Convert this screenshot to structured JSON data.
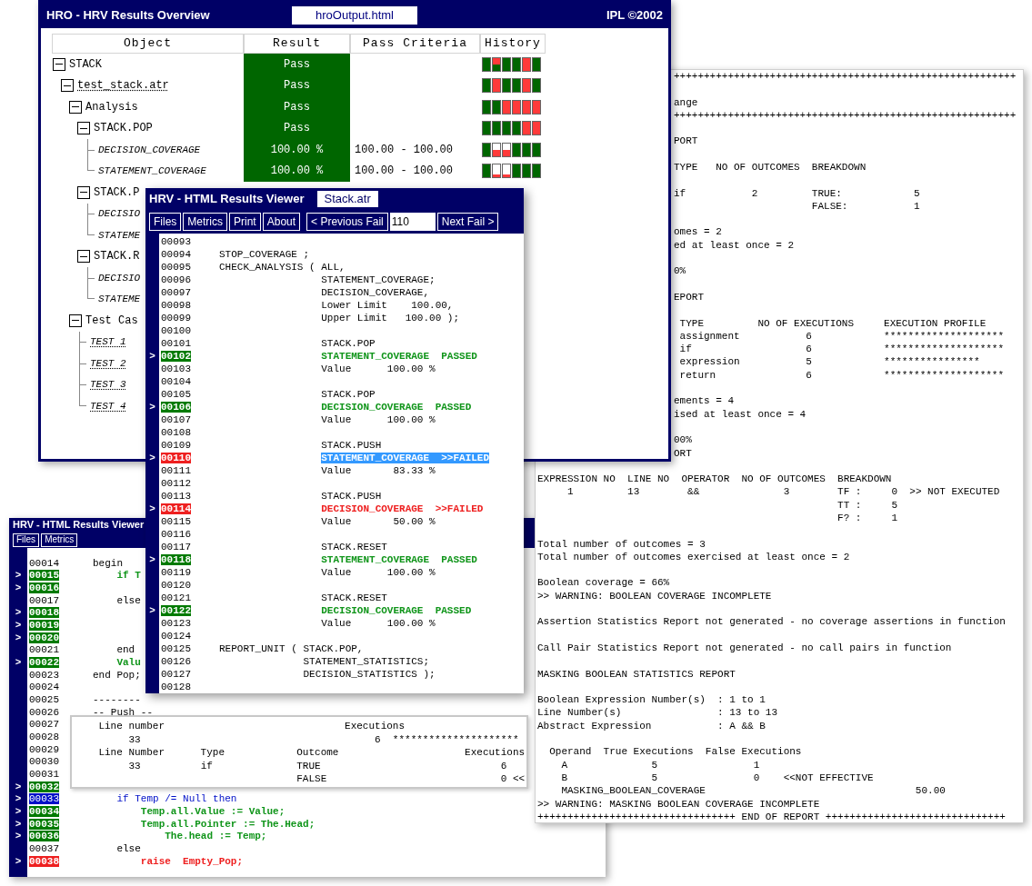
{
  "report_window": {
    "upper_blocks": [
      [
        "+++++++++++++++++++++++++++++++++++++++++++++++++++++++++"
      ],
      [
        "ange",
        "+++++++++++++++++++++++++++++++++++++++++++++++++++++++++"
      ],
      [
        "PORT"
      ],
      [
        "TYPE   NO OF OUTCOMES  BREAKDOWN"
      ],
      [
        "if           2         TRUE:            5",
        "                       FALSE:           1"
      ],
      [
        "omes = 2",
        "ed at least once = 2"
      ],
      [
        "0%"
      ],
      [
        "EPORT"
      ],
      [
        " TYPE         NO OF EXECUTIONS     EXECUTION PROFILE",
        " assignment           6            ********************",
        " if                   6            ********************",
        " expression           5            ****************",
        " return               6            ********************"
      ],
      [
        "ements = 4",
        "ised at least once = 4"
      ],
      [
        "00%",
        "ORT"
      ]
    ],
    "lower_blocks": [
      [
        "EXPRESSION NO  LINE NO  OPERATOR  NO OF OUTCOMES  BREAKDOWN",
        "     1         13        &&              3        TF :     0  >> NOT EXECUTED",
        "                                                  TT :     5",
        "                                                  F? :     1"
      ],
      [
        "Total number of outcomes = 3",
        "Total number of outcomes exercised at least once = 2"
      ],
      [
        "Boolean coverage = 66%",
        ">> WARNING: BOOLEAN COVERAGE INCOMPLETE"
      ],
      [
        "Assertion Statistics Report not generated - no coverage assertions in function"
      ],
      [
        "Call Pair Statistics Report not generated - no call pairs in function"
      ],
      [
        "MASKING BOOLEAN STATISTICS REPORT"
      ],
      [
        "Boolean Expression Number(s)  : 1 to 1",
        "Line Number(s)                : 13 to 13",
        "Abstract Expression           : A && B"
      ],
      [
        "  Operand  True Executions  False Executions",
        "    A              5                1",
        "    B              5                0    <<NOT EFFECTIVE",
        "    MASKING_BOOLEAN_COVERAGE                                   50.00",
        ">> WARNING: MASKING BOOLEAN COVERAGE INCOMPLETE",
        "+++++++++++++++++++++++++++++++++ END OF REPORT ++++++++++++++++++++++++++++++"
      ]
    ]
  },
  "overview_window": {
    "title": "HRO - HRV Results Overview",
    "file": "hroOutput.html",
    "copyright": "IPL ©2002",
    "columns": [
      "Object",
      "Result",
      "Pass Criteria",
      "History"
    ],
    "tree": [
      {
        "label": "STACK",
        "kind": "node",
        "expanded": true,
        "result": "Pass",
        "history": [
          {
            "kind": "pass"
          },
          {
            "kind": "fail_over_pass"
          },
          {
            "kind": "pass"
          },
          {
            "kind": "pass"
          },
          {
            "kind": "fail"
          },
          {
            "kind": "pass"
          }
        ],
        "children": [
          {
            "label": "test_stack.atr",
            "kind": "file",
            "expanded": true,
            "result": "Pass",
            "history": [
              {
                "kind": "pass"
              },
              {
                "kind": "fail"
              },
              {
                "kind": "pass"
              },
              {
                "kind": "pass"
              },
              {
                "kind": "fail"
              },
              {
                "kind": "pass"
              }
            ],
            "children": [
              {
                "label": "Analysis",
                "kind": "node",
                "expanded": true,
                "result": "Pass",
                "history": [
                  {
                    "kind": "pass"
                  },
                  {
                    "kind": "pass"
                  },
                  {
                    "kind": "fail"
                  },
                  {
                    "kind": "fail"
                  },
                  {
                    "kind": "fail"
                  },
                  {
                    "kind": "fail"
                  }
                ],
                "children": [
                  {
                    "label": "STACK.POP",
                    "kind": "node",
                    "expanded": true,
                    "result": "Pass",
                    "history": [
                      {
                        "kind": "pass"
                      },
                      {
                        "kind": "pass"
                      },
                      {
                        "kind": "pass"
                      },
                      {
                        "kind": "pass"
                      },
                      {
                        "kind": "fail"
                      },
                      {
                        "kind": "fail"
                      }
                    ],
                    "children": [
                      {
                        "label": "DECISION_COVERAGE",
                        "kind": "metric",
                        "result": "100.00 %",
                        "criteria": "100.00 - 100.00",
                        "history": [
                          {
                            "kind": "pass"
                          },
                          {
                            "kind": "partial",
                            "level": 0.45
                          },
                          {
                            "kind": "partial",
                            "level": 0.45
                          },
                          {
                            "kind": "pass"
                          },
                          {
                            "kind": "pass"
                          },
                          {
                            "kind": "pass"
                          }
                        ]
                      },
                      {
                        "label": "STATEMENT_COVERAGE",
                        "kind": "metric",
                        "result": "100.00 %",
                        "criteria": "100.00 - 100.00",
                        "history": [
                          {
                            "kind": "pass"
                          },
                          {
                            "kind": "partial",
                            "level": 0.2
                          },
                          {
                            "kind": "partial",
                            "level": 0.2
                          },
                          {
                            "kind": "pass"
                          },
                          {
                            "kind": "pass"
                          },
                          {
                            "kind": "pass"
                          }
                        ]
                      }
                    ]
                  },
                  {
                    "label": "STACK.P",
                    "kind": "node",
                    "expanded": true,
                    "children": [
                      {
                        "label": "DECISIO",
                        "kind": "metric"
                      },
                      {
                        "label": "STATEME",
                        "kind": "metric"
                      }
                    ]
                  },
                  {
                    "label": "STACK.R",
                    "kind": "node",
                    "expanded": true,
                    "children": [
                      {
                        "label": "DECISIO",
                        "kind": "metric"
                      },
                      {
                        "label": "STATEME",
                        "kind": "metric"
                      }
                    ]
                  }
                ]
              },
              {
                "label": "Test Cas",
                "kind": "node",
                "expanded": true,
                "children": [
                  {
                    "label": "TEST 1",
                    "kind": "test"
                  },
                  {
                    "label": "TEST 2",
                    "kind": "test"
                  },
                  {
                    "label": "TEST 3",
                    "kind": "test"
                  },
                  {
                    "label": "TEST 4",
                    "kind": "test"
                  }
                ]
              }
            ]
          }
        ]
      }
    ]
  },
  "lower_viewer": {
    "title": "HRV - HTML Results Viewer",
    "buttons": [
      "Files",
      "Metrics"
    ],
    "lines": [
      {
        "number": "00014",
        "kind": "plain",
        "code": "begin"
      },
      {
        "number": "00015",
        "kind": "pass",
        "marker": ">",
        "code": "    if T"
      },
      {
        "number": "00016",
        "kind": "pass",
        "marker": ">"
      },
      {
        "number": "00017",
        "kind": "plain",
        "code": "    else"
      },
      {
        "number": "00018",
        "kind": "pass",
        "marker": ">"
      },
      {
        "number": "00019",
        "kind": "pass",
        "marker": ">"
      },
      {
        "number": "00020",
        "kind": "pass",
        "marker": ">"
      },
      {
        "number": "00021",
        "kind": "plain",
        "code": "    end"
      },
      {
        "number": "00022",
        "kind": "pass",
        "marker": ">",
        "code": "    Valu"
      },
      {
        "number": "00023",
        "kind": "plain",
        "code": "end Pop;"
      },
      {
        "number": "00024",
        "kind": "plain"
      },
      {
        "number": "00025",
        "kind": "plain",
        "code": "--------"
      },
      {
        "number": "00026",
        "kind": "plain",
        "code": "-- Push --"
      },
      {
        "number": "00027",
        "kind": "plain"
      },
      {
        "number": "00028",
        "kind": "plain"
      },
      {
        "number": "00029",
        "kind": "plain"
      },
      {
        "number": "00030",
        "kind": "plain"
      },
      {
        "number": "00031",
        "kind": "plain"
      },
      {
        "number": "00032",
        "kind": "pass",
        "marker": ">"
      },
      {
        "number": "00033",
        "kind": "current",
        "marker": ">",
        "code": "    if Temp /= Null then"
      },
      {
        "number": "00034",
        "kind": "pass",
        "marker": ">",
        "code": "        Temp.all.Value := Value;"
      },
      {
        "number": "00035",
        "kind": "pass",
        "marker": ">",
        "code": "        Temp.all.Pointer := The.Head;"
      },
      {
        "number": "00036",
        "kind": "pass",
        "marker": ">",
        "code": "            The.head := Temp;"
      },
      {
        "number": "00037",
        "kind": "plain",
        "code": "    else"
      },
      {
        "number": "00038",
        "kind": "fail",
        "marker": ">",
        "code": "        raise  Empty_Pop;"
      }
    ],
    "popup": [
      "    Line number                              Executions",
      "         33                                       6  *********************",
      "    Line Number      Type            Outcome                     Executions",
      "         33          if              TRUE                              6",
      "                                     FALSE                             0 <<"
    ]
  },
  "viewer_window": {
    "title": "HRV - HTML Results Viewer",
    "tab": "Stack.atr",
    "buttons": [
      "Files",
      "Metrics",
      "Print",
      "About"
    ],
    "previous": "< Previous Fail",
    "fail_line": "110",
    "next": "Next Fail >",
    "lines": [
      {
        "number": "00093",
        "kind": "plain",
        "selected": false
      },
      {
        "number": "00094",
        "kind": "plain",
        "selected": false,
        "code": "STOP_COVERAGE ;"
      },
      {
        "number": "00095",
        "kind": "plain",
        "selected": false,
        "code": "CHECK_ANALYSIS ( ALL,"
      },
      {
        "number": "00096",
        "kind": "plain",
        "selected": false,
        "code": "                 STATEMENT_COVERAGE;"
      },
      {
        "number": "00097",
        "kind": "plain",
        "selected": false,
        "code": "                 DECISION_COVERAGE,"
      },
      {
        "number": "00098",
        "kind": "plain",
        "selected": false,
        "code": "                 Lower Limit    100.00,"
      },
      {
        "number": "00099",
        "kind": "plain",
        "selected": false,
        "code": "                 Upper Limit   100.00 );"
      },
      {
        "number": "00100",
        "kind": "plain",
        "selected": false
      },
      {
        "number": "00101",
        "kind": "plain",
        "selected": false,
        "code": "                 STACK.POP"
      },
      {
        "number": "00102",
        "kind": "pass",
        "selected": false,
        "marker": ">",
        "code": "                 STATEMENT_COVERAGE  PASSED"
      },
      {
        "number": "00103",
        "kind": "plain",
        "selected": false,
        "code": "                 Value      100.00 %"
      },
      {
        "number": "00104",
        "kind": "plain",
        "selected": false
      },
      {
        "number": "00105",
        "kind": "plain",
        "selected": false,
        "code": "                 STACK.POP"
      },
      {
        "number": "00106",
        "kind": "pass",
        "selected": false,
        "marker": ">",
        "code": "                 DECISION_COVERAGE  PASSED"
      },
      {
        "number": "00107",
        "kind": "plain",
        "selected": false,
        "code": "                 Value      100.00 %"
      },
      {
        "number": "00108",
        "kind": "plain",
        "selected": false
      },
      {
        "number": "00109",
        "kind": "plain",
        "selected": false,
        "code": "                 STACK.PUSH"
      },
      {
        "number": "00110",
        "kind": "fail",
        "selected": true,
        "marker": ">",
        "code": "                 STATEMENT_COVERAGE  >>FAILED"
      },
      {
        "number": "00111",
        "kind": "plain",
        "selected": false,
        "code": "                 Value       83.33 %"
      },
      {
        "number": "00112",
        "kind": "plain",
        "selected": false
      },
      {
        "number": "00113",
        "kind": "plain",
        "selected": false,
        "code": "                 STACK.PUSH"
      },
      {
        "number": "00114",
        "kind": "fail",
        "selected": false,
        "marker": ">",
        "code": "                 DECISION_COVERAGE  >>FAILED"
      },
      {
        "number": "00115",
        "kind": "plain",
        "selected": false,
        "code": "                 Value       50.00 %"
      },
      {
        "number": "00116",
        "kind": "plain",
        "selected": false
      },
      {
        "number": "00117",
        "kind": "plain",
        "selected": false,
        "code": "                 STACK.RESET"
      },
      {
        "number": "00118",
        "kind": "pass",
        "selected": false,
        "marker": ">",
        "code": "                 STATEMENT_COVERAGE  PASSED"
      },
      {
        "number": "00119",
        "kind": "plain",
        "selected": false,
        "code": "                 Value      100.00 %"
      },
      {
        "number": "00120",
        "kind": "plain",
        "selected": false
      },
      {
        "number": "00121",
        "kind": "plain",
        "selected": false,
        "code": "                 STACK.RESET"
      },
      {
        "number": "00122",
        "kind": "pass",
        "selected": false,
        "marker": ">",
        "code": "                 DECISION_COVERAGE  PASSED"
      },
      {
        "number": "00123",
        "kind": "plain",
        "selected": false,
        "code": "                 Value      100.00 %"
      },
      {
        "number": "00124",
        "kind": "plain",
        "selected": false
      },
      {
        "number": "00125",
        "kind": "plain",
        "selected": false,
        "code": "REPORT_UNIT ( STACK.POP,"
      },
      {
        "number": "00126",
        "kind": "plain",
        "selected": false,
        "code": "              STATEMENT_STATISTICS;"
      },
      {
        "number": "00127",
        "kind": "plain",
        "selected": false,
        "code": "              DECISION_STATISTICS );"
      },
      {
        "number": "00128",
        "kind": "plain",
        "selected": false
      }
    ]
  }
}
